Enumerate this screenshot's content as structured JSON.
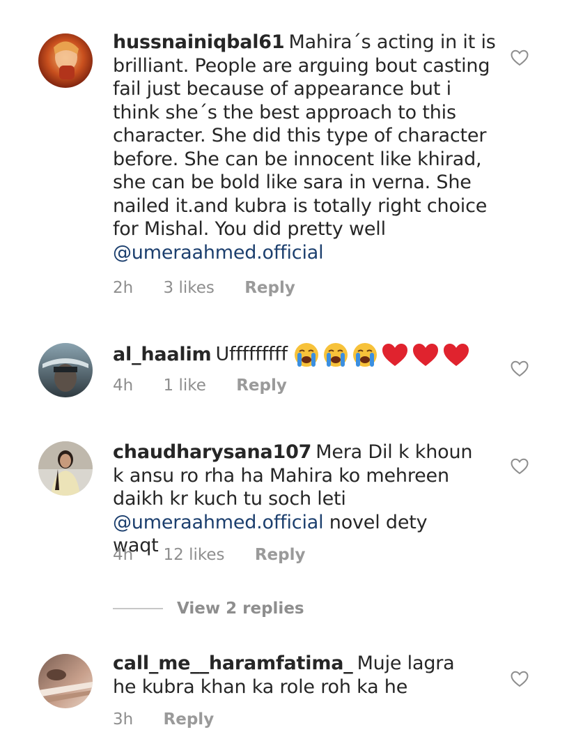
{
  "comments": [
    {
      "username": "hussnainiqbal61",
      "text": "Mahira´s acting in it is brilliant. People are arguing bout casting fail just because of appearance but i think she´s the best approach to this character. She did this type of character before. She can be innocent like khirad, she can be bold like sara in verna. She nailed it.and kubra is totally right choice for Mishal. You did pretty well",
      "mention": "@umeraahmed.official",
      "time": "2h",
      "likes": "3 likes",
      "reply": "Reply"
    },
    {
      "username": "al_haalim",
      "text": "Ufffffffff",
      "emoji": [
        "loudly-crying-face",
        "loudly-crying-face",
        "loudly-crying-face",
        "red-heart",
        "red-heart",
        "red-heart"
      ],
      "time": "4h",
      "likes": "1 like",
      "reply": "Reply"
    },
    {
      "username": "chaudharysana107",
      "text": "Mera Dil k khoun k ansu ro rha ha Mahira ko mehreen daikh kr kuch tu soch leti",
      "mention": "@umeraahmed.official",
      "text_after": "novel dety waqt",
      "time": "4h",
      "likes": "12 likes",
      "reply": "Reply"
    },
    {
      "username": "call_me__haramfatima_",
      "text": "Muje lagra he kubra khan ka role roh ka he",
      "time": "3h",
      "reply": "Reply"
    }
  ],
  "view_replies": "View 2 replies",
  "colors": {
    "mention": "#1c3f6e",
    "meta": "#8e8e8e",
    "text": "#262626",
    "heart_emoji": "#e0232e"
  },
  "icons": {
    "like": "heart-outline-icon"
  }
}
